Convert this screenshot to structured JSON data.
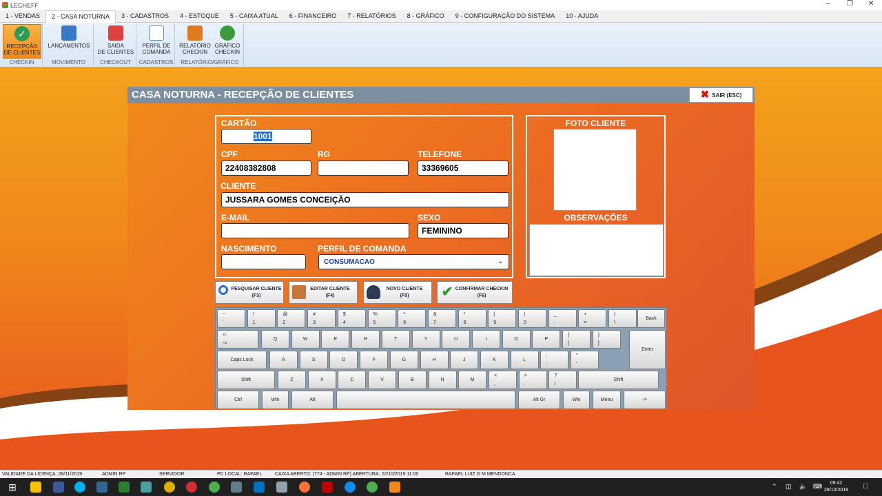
{
  "window": {
    "title": "LECHEFF"
  },
  "menu": [
    "1 - VENDAS",
    "2 - CASA NOTURNA",
    "3 - CADASTROS",
    "4 - ESTOQUE",
    "5 - CAIXA ATUAL",
    "6 - FINANCEIRO",
    "7 - RELATÓRIOS",
    "8 - GRÁFICO",
    "9 - CONFIGURAÇÃO DO SISTEMA",
    "10 - AJUDA"
  ],
  "ribbon": {
    "groups": [
      "CHECKIN",
      "MOVIMENTO",
      "CHECKOUT",
      "CADASTROS",
      "RELATÓRIO/GRÁFICO"
    ],
    "buttons": [
      {
        "l1": "RECEPÇÃO",
        "l2": "DE CLIENTES",
        "color": "#2a9d55"
      },
      {
        "l1": "",
        "l2": "LANÇAMENTOS",
        "color": "#3a78c8"
      },
      {
        "l1": "SAIDA",
        "l2": "DE CLIENTES",
        "color": "#e04040"
      },
      {
        "l1": "PERFIL DE",
        "l2": "COMANDA",
        "color": "#5a8fd8"
      },
      {
        "l1": "RELATÓRIO",
        "l2": "CHECKIN",
        "color": "#e07a20"
      },
      {
        "l1": "GRÁFICO",
        "l2": "CHECKIN",
        "color": "#3b9a3b"
      }
    ]
  },
  "panel": {
    "title": "CASA NOTURNA - RECEPÇÃO DE CLIENTES",
    "exit": "SAIR (ESC)"
  },
  "form": {
    "cartao_label": "CARTÃO",
    "cartao": "1001",
    "cpf_label": "CPF",
    "cpf": "22408382808",
    "rg_label": "RG",
    "rg": "",
    "telefone_label": "TELEFONE",
    "telefone": "33369605",
    "cliente_label": "CLIENTE",
    "cliente": "JUSSARA GOMES CONCEIÇÃO",
    "email_label": "E-MAIL",
    "email": "",
    "sexo_label": "SEXO",
    "sexo": "FEMININO",
    "nascimento_label": "NASCIMENTO",
    "nascimento": "",
    "perfil_label": "PERFIL DE COMANDA",
    "perfil": "CONSUMACAO",
    "foto_label": "FOTO CLIENTE",
    "obs_label": "OBSERVAÇÕES"
  },
  "actions": [
    {
      "l1": "PESQUISAR CLIENTE",
      "l2": "(F3)"
    },
    {
      "l1": "EDITAR CLIENTE",
      "l2": "(F4)"
    },
    {
      "l1": "NOVO CLIENTE",
      "l2": "(F5)"
    },
    {
      "l1": "CONFIRMAR CHECKIN",
      "l2": "(F6)"
    }
  ],
  "keyboard": {
    "row1": [
      [
        "~",
        "`"
      ],
      [
        "!",
        "1"
      ],
      [
        "@",
        "2"
      ],
      [
        "#",
        "3"
      ],
      [
        "$",
        "4"
      ],
      [
        "%",
        "5"
      ],
      [
        "^",
        "6"
      ],
      [
        "&",
        "7"
      ],
      [
        "*",
        "8"
      ],
      [
        "(",
        "9"
      ],
      [
        ")",
        "0"
      ],
      [
        "_",
        "-"
      ],
      [
        "+",
        "="
      ],
      [
        "|",
        "\\"
      ]
    ],
    "backspace": "Back",
    "tab": [
      "<-",
      "->"
    ],
    "row2": [
      "Q",
      "W",
      "E",
      "R",
      "T",
      "Y",
      "U",
      "I",
      "O",
      "P"
    ],
    "row2b": [
      [
        "{",
        "["
      ],
      [
        "}",
        "]"
      ]
    ],
    "enter": "Enter",
    "caps": "Caps Lock",
    "row3": [
      "A",
      "S",
      "D",
      "F",
      "G",
      "H",
      "J",
      "K",
      "L"
    ],
    "row3b": [
      [
        ":",
        ";"
      ],
      [
        "\"",
        "'"
      ]
    ],
    "shift": "Shift",
    "row4": [
      "Z",
      "X",
      "C",
      "V",
      "B",
      "N",
      "M"
    ],
    "row4b": [
      [
        "<",
        ","
      ],
      [
        ">",
        "."
      ],
      [
        "?",
        "/"
      ]
    ],
    "bottom": {
      "ctrl": "Ctrl",
      "win": "Win",
      "alt": "Alt",
      "altgr": "Alt Gr",
      "menu": "Menu",
      "arrow": "->"
    }
  },
  "status": [
    "VALIDADE DA LICENÇA: 28/11/2019",
    "ADMIN RP",
    "SERVIDOR:",
    "PC LOCAL: RAFAEL",
    "CAIXA ABERTO: (774 - ADMIN RP) ABERTURA: 22/10/2019 11:00",
    "RAFAEL LUIZ G M MENDONCA"
  ],
  "taskbar": {
    "time": "09:42",
    "date": "28/10/2019"
  }
}
